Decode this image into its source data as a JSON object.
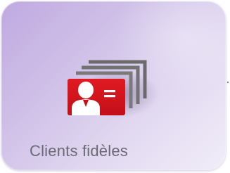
{
  "tile": {
    "label": "Clients fidèles",
    "icon": "stacked-client-id-cards-icon",
    "colors": {
      "background_start": "#bfa9e0",
      "background_end": "#f1edf8",
      "card_red": "#d0121c",
      "card_back_gray": "#6e6e6e",
      "label_text": "#6a6a72"
    }
  }
}
